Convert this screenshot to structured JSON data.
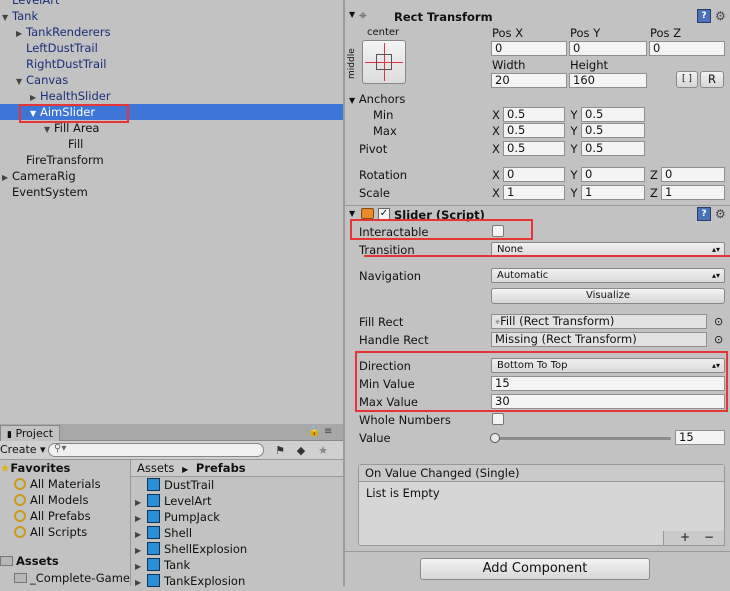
{
  "hierarchy": {
    "items": [
      {
        "label": "LevelArt",
        "indent": 0,
        "arrow": "",
        "color": "blue"
      },
      {
        "label": "Tank",
        "indent": 0,
        "arrow": "down",
        "color": "blue"
      },
      {
        "label": "TankRenderers",
        "indent": 1,
        "arrow": "right",
        "color": "blue"
      },
      {
        "label": "LeftDustTrail",
        "indent": 1,
        "arrow": "",
        "color": "blue"
      },
      {
        "label": "RightDustTrail",
        "indent": 1,
        "arrow": "",
        "color": "blue"
      },
      {
        "label": "Canvas",
        "indent": 1,
        "arrow": "down",
        "color": "blue"
      },
      {
        "label": "HealthSlider",
        "indent": 2,
        "arrow": "right",
        "color": "blue"
      },
      {
        "label": "AimSlider",
        "indent": 2,
        "arrow": "down",
        "color": "blue",
        "selected": true
      },
      {
        "label": "Fill Area",
        "indent": 3,
        "arrow": "down",
        "color": "black"
      },
      {
        "label": "Fill",
        "indent": 4,
        "arrow": "",
        "color": "black"
      },
      {
        "label": "FireTransform",
        "indent": 1,
        "arrow": "",
        "color": "black"
      },
      {
        "label": "CameraRig",
        "indent": 0,
        "arrow": "right",
        "color": "black"
      },
      {
        "label": "EventSystem",
        "indent": 0,
        "arrow": "",
        "color": "black"
      }
    ]
  },
  "project": {
    "tab_label": "Project",
    "create_label": "Create",
    "favorites_label": "Favorites",
    "favorites": [
      "All Materials",
      "All Models",
      "All Prefabs",
      "All Scripts"
    ],
    "assets_label": "Assets",
    "assets_children": [
      "_Complete-Game"
    ],
    "breadcrumb_root": "Assets",
    "breadcrumb_current": "Prefabs",
    "files": [
      "DustTrail",
      "LevelArt",
      "PumpJack",
      "Shell",
      "ShellExplosion",
      "Tank",
      "TankExplosion"
    ]
  },
  "rect_transform": {
    "title": "Rect Transform",
    "anchor_preset_top": "center",
    "anchor_preset_side": "middle",
    "pos_x_label": "Pos X",
    "pos_y_label": "Pos Y",
    "pos_z_label": "Pos Z",
    "pos_x": "0",
    "pos_y": "0",
    "pos_z": "0",
    "width_label": "Width",
    "height_label": "Height",
    "width": "20",
    "height": "160",
    "r_button": "R",
    "anchors_label": "Anchors",
    "min_label": "Min",
    "max_label": "Max",
    "anchor_min_x": "0.5",
    "anchor_min_y": "0.5",
    "anchor_max_x": "0.5",
    "anchor_max_y": "0.5",
    "pivot_label": "Pivot",
    "pivot_x": "0.5",
    "pivot_y": "0.5",
    "rotation_label": "Rotation",
    "rot_x": "0",
    "rot_y": "0",
    "rot_z": "0",
    "scale_label": "Scale",
    "scale_x": "1",
    "scale_y": "1",
    "scale_z": "1",
    "x": "X",
    "y": "Y",
    "z": "Z"
  },
  "slider": {
    "title": "Slider (Script)",
    "interactable_label": "Interactable",
    "transition_label": "Transition",
    "transition_value": "None",
    "navigation_label": "Navigation",
    "navigation_value": "Automatic",
    "visualize_label": "Visualize",
    "fill_rect_label": "Fill Rect",
    "fill_rect_value": "Fill (Rect Transform)",
    "handle_rect_label": "Handle Rect",
    "handle_rect_value": "Missing (Rect Transform)",
    "direction_label": "Direction",
    "direction_value": "Bottom To Top",
    "min_value_label": "Min Value",
    "min_value": "15",
    "max_value_label": "Max Value",
    "max_value": "30",
    "whole_numbers_label": "Whole Numbers",
    "value_label": "Value",
    "value": "15",
    "event_label": "On Value Changed (Single)",
    "event_empty": "List is Empty",
    "plus": "+",
    "minus": "−"
  },
  "add_component_label": "Add Component",
  "colors": {
    "selection": "#3d76d6",
    "highlight": "#e53535"
  }
}
